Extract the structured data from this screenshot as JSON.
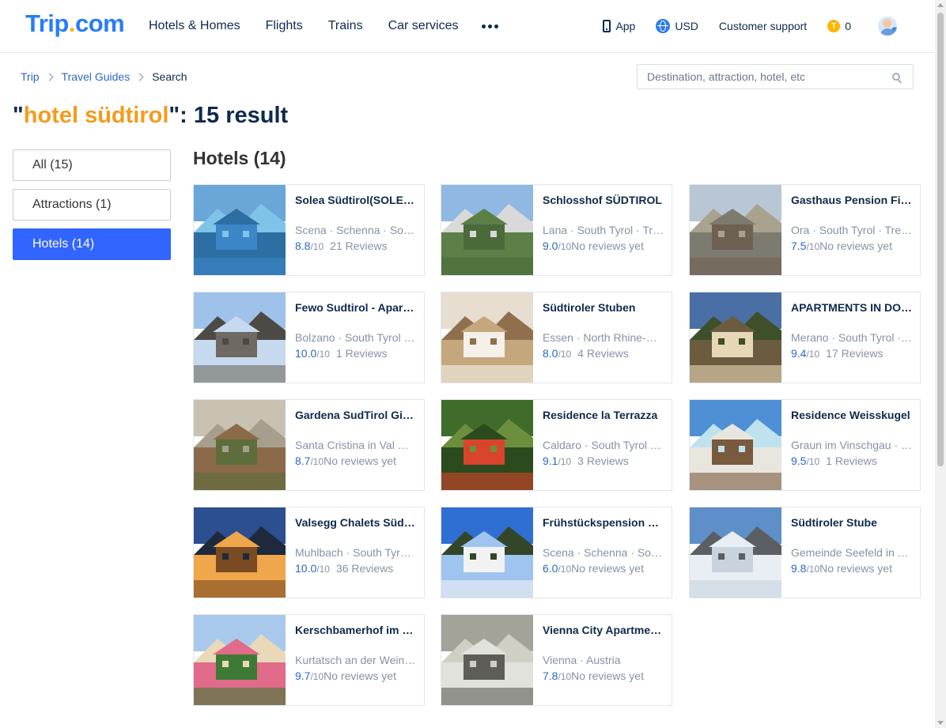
{
  "header": {
    "logo": {
      "trip": "Trip",
      "dot": ".",
      "com": "com"
    },
    "nav": [
      "Hotels & Homes",
      "Flights",
      "Trains",
      "Car services"
    ],
    "app_label": "App",
    "currency": "USD",
    "support": "Customer support",
    "coin_symbol": "T",
    "coins": "0"
  },
  "breadcrumb": {
    "items": [
      "Trip",
      "Travel Guides"
    ],
    "current": "Search"
  },
  "search": {
    "placeholder": "Destination, attraction, hotel, etc"
  },
  "result": {
    "quote_open": "\"",
    "keyword": "hotel südtirol",
    "suffix": "\": 15 result"
  },
  "filters": [
    {
      "label": "All (15)",
      "active": false
    },
    {
      "label": "Attractions (1)",
      "active": false
    },
    {
      "label": "Hotels (14)",
      "active": true
    }
  ],
  "section_title": "Hotels (14)",
  "rating_suffix": "/10",
  "hotels": [
    {
      "name": "Solea Südtirol(SOLEA Hotel)",
      "location": "Scena · Schenna · South Tyrol · Trentino-Alto Adige",
      "score": "8.8",
      "reviews": "21 Reviews",
      "palette": [
        "#6aa7d8",
        "#2d6ea3",
        "#3a86c6",
        "#7fc3e8"
      ]
    },
    {
      "name": "Schlosshof SÜDTIROL",
      "location": "Lana · South Tyrol · Trentino-Alto Adige",
      "score": "9.0",
      "reviews": "No reviews yet",
      "palette": [
        "#8fb8e3",
        "#5b7f46",
        "#4b6a3a",
        "#d9d9d9"
      ]
    },
    {
      "name": "Gasthaus Pension Fichtenhof",
      "location": "Ora · South Tyrol · Trentino-Alto Adige",
      "score": "7.5",
      "reviews": "No reviews yet",
      "palette": [
        "#b9c7d4",
        "#7d7a70",
        "#6f6152",
        "#a8a28f"
      ]
    },
    {
      "name": "Fewo Sudtirol - Apartment",
      "location": "Bolzano · South Tyrol · Trentino-Alto Adige",
      "score": "10.0",
      "reviews": "1 Reviews",
      "palette": [
        "#9ec2ea",
        "#c7d9ee",
        "#6e6a63",
        "#4d4a46"
      ]
    },
    {
      "name": "Südtiroler Stuben",
      "location": "Essen · North Rhine-Westphalia · Germany",
      "score": "8.0",
      "reviews": "4 Reviews",
      "palette": [
        "#e7ddd0",
        "#c4a77d",
        "#f5f1ea",
        "#8f6f4d"
      ]
    },
    {
      "name": "APARTMENTS IN DORF TIROL",
      "location": "Merano · South Tyrol · Trentino-Alto Adige",
      "score": "9.4",
      "reviews": "17 Reviews",
      "palette": [
        "#4a6fa5",
        "#6b5c40",
        "#e7d7b6",
        "#3e4f2a"
      ]
    },
    {
      "name": "Gardena SudTirol Giardin",
      "location": "Santa Cristina in Val Gardena · South Tyrol",
      "score": "8.7",
      "reviews": "No reviews yet",
      "palette": [
        "#c9c2b2",
        "#8b6a4a",
        "#5d6d3c",
        "#a79f8d"
      ]
    },
    {
      "name": "Residence la Terrazza",
      "location": "Caldaro · South Tyrol · Trentino-Alto Adige",
      "score": "9.1",
      "reviews": "3 Reviews",
      "palette": [
        "#3f6b2b",
        "#2b4a1e",
        "#d9452c",
        "#6c8f3e"
      ]
    },
    {
      "name": "Residence Weisskugel",
      "location": "Graun im Vinschgau · South Tyrol",
      "score": "9.5",
      "reviews": "1 Reviews",
      "palette": [
        "#4f8fd6",
        "#e9e6e0",
        "#7a5a3e",
        "#bfe3ee"
      ]
    },
    {
      "name": "Valsegg Chalets Südtirol",
      "location": "Muhlbach · South Tyrol · Trentino-Alto Adige",
      "score": "10.0",
      "reviews": "36 Reviews",
      "palette": [
        "#2c4f8f",
        "#f0a64a",
        "#7a4a22",
        "#1e2a3c"
      ]
    },
    {
      "name": "Frühstückspension Sonnenheim",
      "location": "Scena · Schenna · South Tyrol",
      "score": "6.0",
      "reviews": "No reviews yet",
      "palette": [
        "#2f6fd1",
        "#9ec4ef",
        "#f2f2f2",
        "#33462a"
      ]
    },
    {
      "name": "Südtiroler Stube",
      "location": "Gemeinde Seefeld in Tirol · Tyrol",
      "score": "9.8",
      "reviews": "No reviews yet",
      "palette": [
        "#5f8fc9",
        "#e9eef4",
        "#c9d3de",
        "#5b5e63"
      ]
    },
    {
      "name": "Kerschbamerhof im Obstgarten",
      "location": "Kurtatsch an der Weinstrasse · South Tyrol",
      "score": "9.7",
      "reviews": "No reviews yet",
      "palette": [
        "#a8c9ec",
        "#e06b8a",
        "#3f7a34",
        "#e9d9b9"
      ]
    },
    {
      "name": "Vienna City Apartments",
      "location": "Vienna · Austria",
      "score": "7.8",
      "reviews": "No reviews yet",
      "palette": [
        "#a3a39a",
        "#e2e2dc",
        "#5e5d58",
        "#cfcfc6"
      ]
    }
  ]
}
